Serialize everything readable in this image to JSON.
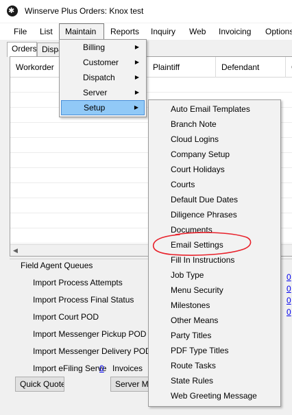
{
  "window": {
    "title": "Winserve Plus Orders: Knox test"
  },
  "menubar": [
    "File",
    "List",
    "Maintain",
    "Reports",
    "Inquiry",
    "Web",
    "Invoicing",
    "Options"
  ],
  "tabs": [
    "Orders",
    "Dispa"
  ],
  "grid": {
    "columns": [
      "Workorder",
      "Plaintiff",
      "Defendant",
      "C"
    ]
  },
  "field_agent_queues": {
    "title": "Field Agent Queues",
    "items": [
      "Import Process Attempts",
      "Import Process Final Status",
      "Import Court POD",
      "Import Messenger Pickup POD",
      "Import Messenger Delivery POD",
      "Import eFiling Serve"
    ],
    "efiling_count": "0",
    "invoices_label": "Invoices",
    "right_counts": [
      "0",
      "0",
      "0",
      "0"
    ]
  },
  "buttons": {
    "quick_quote": "Quick Quote",
    "server_m": "Server M"
  },
  "maintain_menu": {
    "items": [
      {
        "label": "Billing",
        "has_submenu": true
      },
      {
        "label": "Customer",
        "has_submenu": true
      },
      {
        "label": "Dispatch",
        "has_submenu": true
      },
      {
        "label": "Server",
        "has_submenu": true
      },
      {
        "label": "Setup",
        "has_submenu": true,
        "highlighted": true
      }
    ]
  },
  "setup_submenu": {
    "items": [
      "Auto Email Templates",
      "Branch Note",
      "Cloud Logins",
      "Company Setup",
      "Court Holidays",
      "Courts",
      "Default Due Dates",
      "Diligence Phrases",
      "Documents",
      "Email Settings",
      "Fill In Instructions",
      "Job Type",
      "Menu Security",
      "Milestones",
      "Other Means",
      "Party Titles",
      "PDF Type Titles",
      "Route Tasks",
      "State Rules",
      "Web Greeting Message"
    ],
    "circled_item": "Email Settings"
  },
  "colors": {
    "highlight": "#91c9f7",
    "annotation": "#e8202a",
    "link": "#0000ee"
  }
}
